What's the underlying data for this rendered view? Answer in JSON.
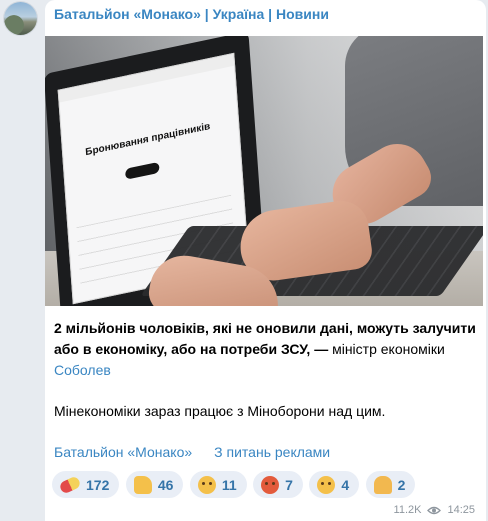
{
  "channel": {
    "title": "Батальйон «Монако» | Україна | Новини"
  },
  "post": {
    "image_screen_heading": "Бронювання працівників",
    "para1_bold": "2 мільйонів чоловіків, які не оновили дані, можуть залучити або в економіку, або на потреби ЗСУ, —",
    "para1_plain": " міністр економіки ",
    "para1_link": "Соболев",
    "para2": "Мінекономіки зараз працює з Міноборони над цим.",
    "footer_links": [
      "Батальйон «Монако»",
      "З питань реклами"
    ]
  },
  "reactions": [
    {
      "icon": "pill-icon",
      "count": "172"
    },
    {
      "icon": "thumbs-up-icon",
      "count": "46"
    },
    {
      "icon": "thinking-face-icon",
      "count": "11"
    },
    {
      "icon": "angry-face-icon",
      "count": "7"
    },
    {
      "icon": "woozy-face-icon",
      "count": "4"
    },
    {
      "icon": "praying-hands-icon",
      "count": "2"
    }
  ],
  "meta": {
    "views": "11.2K",
    "time": "14:25"
  },
  "colors": {
    "accent": "#3a86c2",
    "reaction_bg": "#e9eef6",
    "background": "#e7ebf0"
  }
}
